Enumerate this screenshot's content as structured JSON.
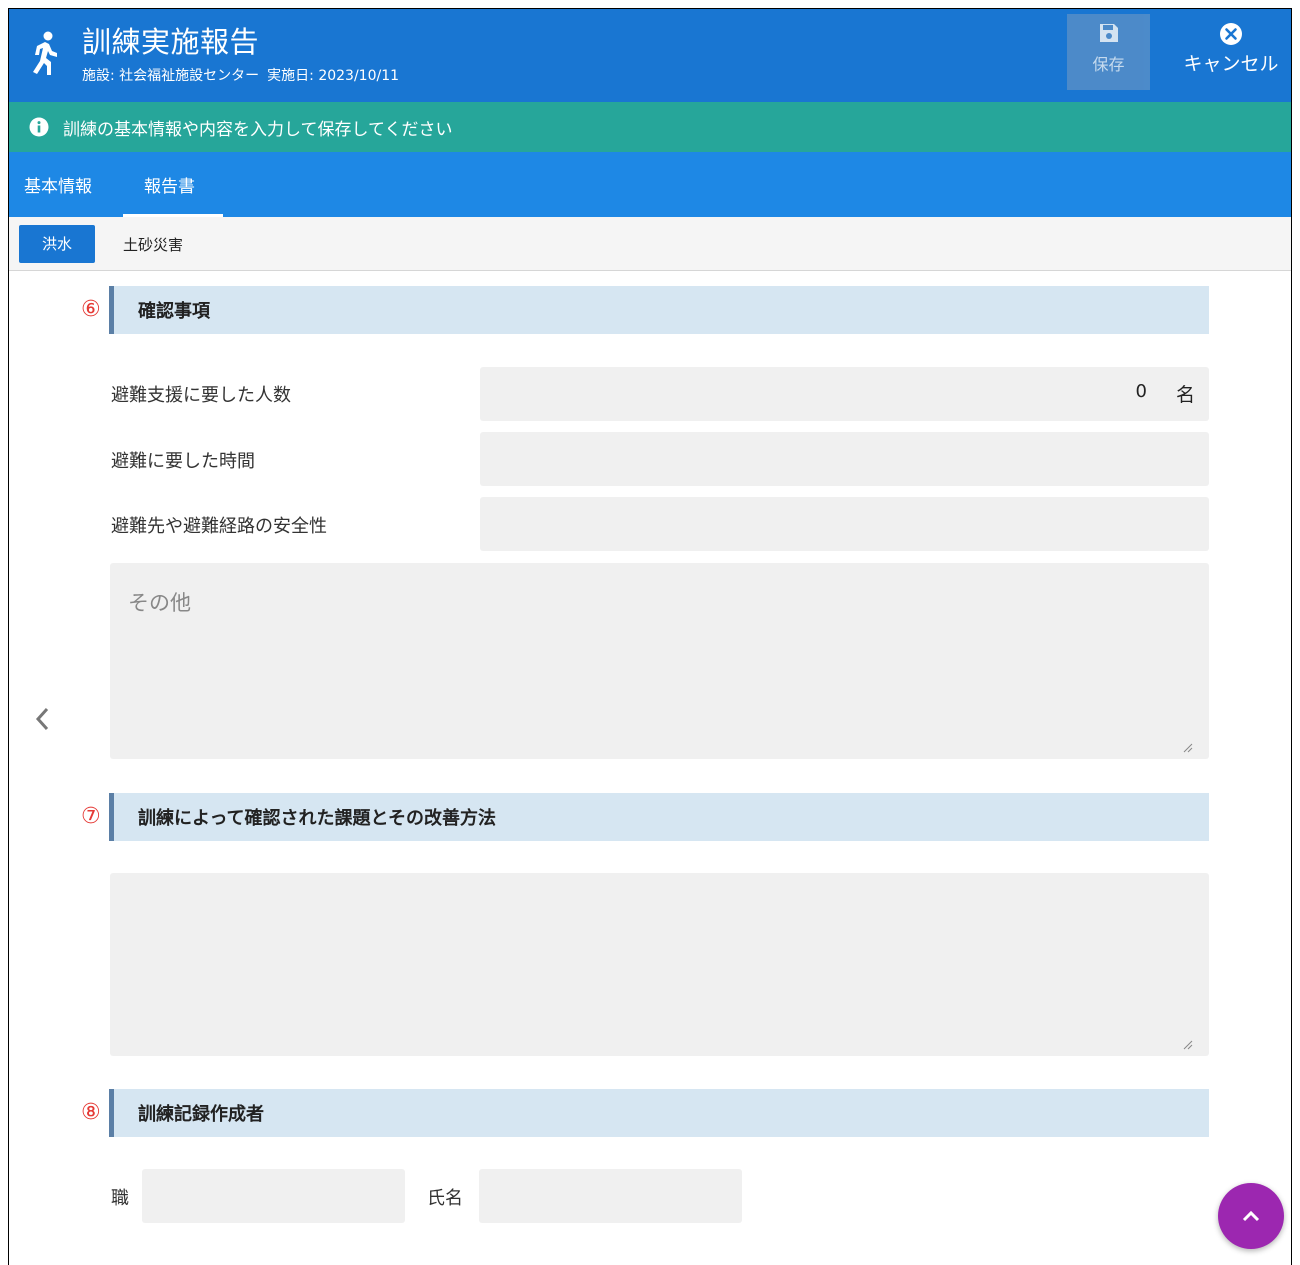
{
  "header": {
    "title": "訓練実施報告",
    "facility": "施設: 社会福祉施設センター",
    "date": "実施日: 2023/10/11",
    "save_label": "保存",
    "cancel_label": "キャンセル",
    "icon": "running-person-icon"
  },
  "banner": {
    "message": "訓練の基本情報や内容を入力して保存してください"
  },
  "tabs": {
    "items": [
      "基本情報",
      "報告書"
    ],
    "selected": "報告書"
  },
  "subtabs": {
    "items": [
      "洪水",
      "土砂災害"
    ],
    "selected": "洪水"
  },
  "sections": [
    {
      "number": "⑥",
      "heading": "確認事項",
      "fields": [
        {
          "label": "避難支援に要した人数",
          "value": "0",
          "unit": "名"
        },
        {
          "label": "避難に要した時間",
          "value": ""
        },
        {
          "label": "避難先や避難経路の安全性",
          "value": ""
        }
      ],
      "textarea_placeholder": "その他"
    },
    {
      "number": "⑦",
      "heading": "訓練によって確認された課題とその改善方法"
    },
    {
      "number": "⑧",
      "heading": "訓練記録作成者",
      "fields": [
        {
          "label": "職",
          "value": ""
        },
        {
          "label": "氏名",
          "value": ""
        }
      ]
    }
  ],
  "colors": {
    "appbar": "#1976d2",
    "banner": "#26a69a",
    "tabs": "#1e88e5",
    "section_bg": "#d6e6f2",
    "number_red": "#e53935",
    "fab": "#9c27b0"
  }
}
